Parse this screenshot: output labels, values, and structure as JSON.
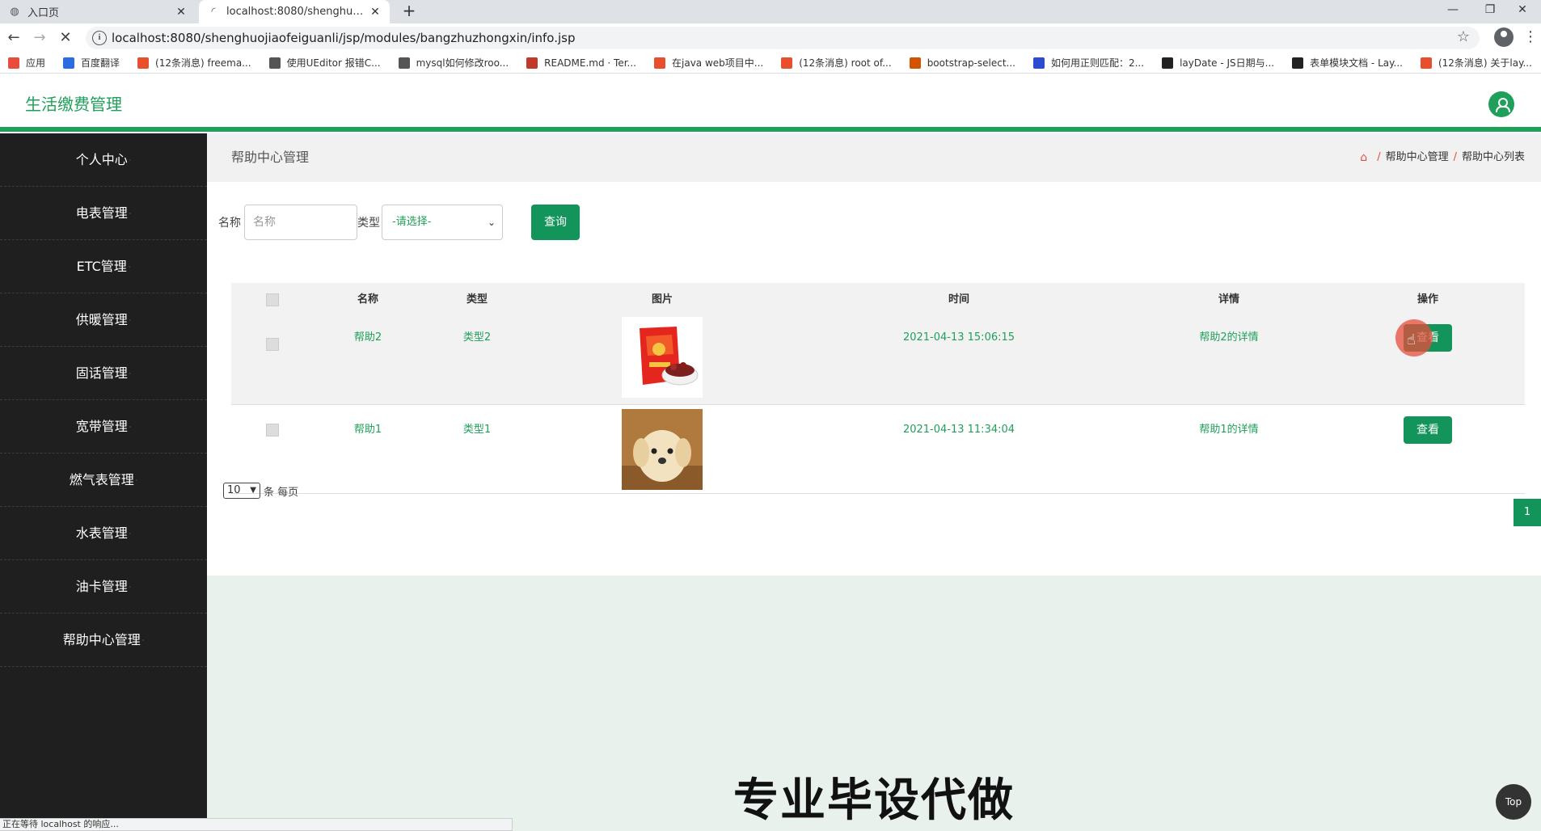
{
  "browser": {
    "tabs": [
      {
        "title": "入口页",
        "active": false
      },
      {
        "title": "localhost:8080/shenghuojiaofe",
        "active": true
      }
    ],
    "new_tab": "+",
    "url": "localhost:8080/shenghuojiaofeiguanli/jsp/modules/bangzhuzhongxin/info.jsp",
    "bookmarks": [
      {
        "label": "应用",
        "color": "#e74c3c"
      },
      {
        "label": "百度翻译",
        "color": "#2b6de0"
      },
      {
        "label": "(12条消息) freema...",
        "color": "#e8502d"
      },
      {
        "label": "使用UEditor 报错C...",
        "color": "#555555"
      },
      {
        "label": "mysql如何修改roo...",
        "color": "#555555"
      },
      {
        "label": "README.md · Ter...",
        "color": "#c0392b"
      },
      {
        "label": "在java web项目中...",
        "color": "#e8502d"
      },
      {
        "label": "(12条消息) root of...",
        "color": "#e8502d"
      },
      {
        "label": "bootstrap-select...",
        "color": "#d35400"
      },
      {
        "label": "如何用正则匹配：2...",
        "color": "#2b4bd0"
      },
      {
        "label": "layDate - JS日期与...",
        "color": "#222222"
      },
      {
        "label": "表单模块文档 - Lay...",
        "color": "#222222"
      },
      {
        "label": "(12条消息) 关于lay...",
        "color": "#e8502d"
      }
    ],
    "status": "正在等待 localhost 的响应..."
  },
  "app": {
    "brand": "生活缴费管理",
    "accent": "#1fa05a"
  },
  "sidebar": {
    "items": [
      {
        "label": "个人中心"
      },
      {
        "label": "电表管理"
      },
      {
        "label": "ETC管理"
      },
      {
        "label": "供暖管理"
      },
      {
        "label": "固话管理"
      },
      {
        "label": "宽带管理"
      },
      {
        "label": "燃气表管理"
      },
      {
        "label": "水表管理"
      },
      {
        "label": "油卡管理"
      },
      {
        "label": "帮助中心管理"
      }
    ]
  },
  "page": {
    "title": "帮助中心管理",
    "breadcrumb": [
      "帮助中心管理",
      "帮助中心列表"
    ]
  },
  "search": {
    "name_label": "名称",
    "name_placeholder": "名称",
    "type_label": "类型",
    "type_selected": "-请选择-",
    "query_button": "查询"
  },
  "table": {
    "headers": [
      "名称",
      "类型",
      "图片",
      "时间",
      "详情",
      "操作"
    ],
    "rows": [
      {
        "name": "帮助2",
        "type": "类型2",
        "image": "red-snack-bag",
        "time": "2021-04-13 15:06:15",
        "detail": "帮助2的详情",
        "action": "查看"
      },
      {
        "name": "帮助1",
        "type": "类型1",
        "image": "puppy",
        "time": "2021-04-13 11:34:04",
        "detail": "帮助1的详情",
        "action": "查看"
      }
    ]
  },
  "pager": {
    "page_size": "10",
    "page_size_text": "条 每页",
    "current_page": "1"
  },
  "banner": "专业毕设代做",
  "top_button": "Top"
}
